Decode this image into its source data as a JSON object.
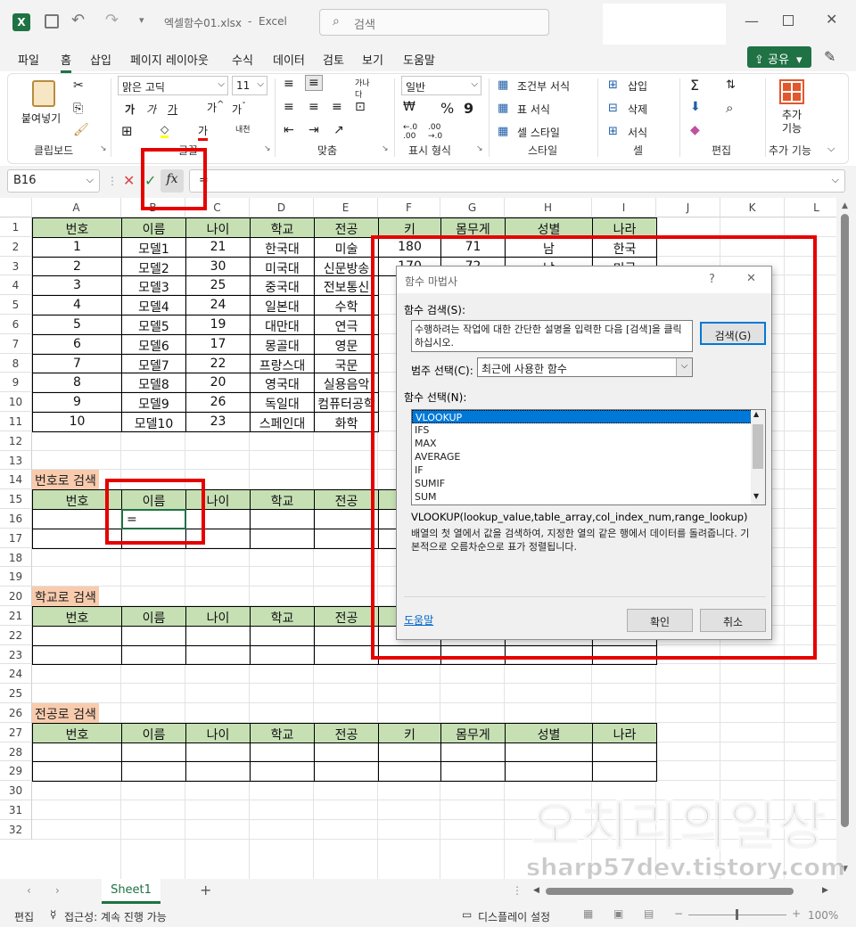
{
  "window": {
    "filename": "엑셀함수01.xlsx",
    "app": "Excel",
    "separator": "-",
    "search_placeholder": "검색"
  },
  "menu": [
    "파일",
    "홈",
    "삽입",
    "페이지 레이아웃",
    "수식",
    "데이터",
    "검토",
    "보기",
    "도움말"
  ],
  "share_label": "공유",
  "ribbon": {
    "paste": "붙여넣기",
    "font_name": "맑은 고딕",
    "font_size": "11",
    "number_format": "일반",
    "cond_format": "조건부 서식",
    "table_format": "표 서식",
    "cell_style": "셀 스타일",
    "insert": "삽입",
    "delete": "삭제",
    "format": "서식",
    "addins": "추가 기능",
    "groups": {
      "clipboard": "클립보드",
      "font": "글꼴",
      "align": "맞춤",
      "number": "표시 형식",
      "style": "스타일",
      "cells": "셀",
      "edit": "편집",
      "addins": "추가 기능"
    }
  },
  "formula_bar": {
    "name_box": "B16",
    "fx": "fx",
    "content": "="
  },
  "columns": [
    "A",
    "B",
    "C",
    "D",
    "E",
    "F",
    "G",
    "H",
    "I",
    "J",
    "K",
    "L"
  ],
  "rows": [
    "1",
    "2",
    "3",
    "4",
    "5",
    "6",
    "7",
    "8",
    "9",
    "10",
    "11",
    "12",
    "13",
    "14",
    "15",
    "16",
    "17",
    "18",
    "19",
    "20",
    "21",
    "22",
    "23",
    "24",
    "25",
    "26",
    "27",
    "28",
    "29",
    "30",
    "31",
    "32"
  ],
  "table": {
    "headers": [
      "번호",
      "이름",
      "나이",
      "학교",
      "전공",
      "키",
      "몸무게",
      "성별",
      "나라"
    ],
    "rows": [
      [
        "1",
        "모델1",
        "21",
        "한국대",
        "미술",
        "180",
        "71",
        "남",
        "한국"
      ],
      [
        "2",
        "모델2",
        "30",
        "미국대",
        "신문방송",
        "170",
        "72",
        "남",
        "미국"
      ],
      [
        "3",
        "모델3",
        "25",
        "중국대",
        "전보통신",
        "",
        "",
        "",
        ""
      ],
      [
        "4",
        "모델4",
        "24",
        "일본대",
        "수학",
        "",
        "",
        "",
        ""
      ],
      [
        "5",
        "모델5",
        "19",
        "대만대",
        "연극",
        "",
        "",
        "",
        ""
      ],
      [
        "6",
        "모델6",
        "17",
        "몽골대",
        "영문",
        "",
        "",
        "",
        ""
      ],
      [
        "7",
        "모델7",
        "22",
        "프랑스대",
        "국문",
        "",
        "",
        "",
        ""
      ],
      [
        "8",
        "모델8",
        "20",
        "영국대",
        "실용음악",
        "",
        "",
        "",
        ""
      ],
      [
        "9",
        "모델9",
        "26",
        "독일대",
        "컴퓨터공학",
        "",
        "",
        "",
        ""
      ],
      [
        "10",
        "모델10",
        "23",
        "스페인대",
        "화학",
        "",
        "",
        "",
        ""
      ]
    ]
  },
  "sections": {
    "by_number": "번호로 검색",
    "by_school": "학교로 검색",
    "by_major": "전공로 검색",
    "cell_b16": "="
  },
  "dialog": {
    "title": "함수 마법사",
    "help_q": "?",
    "close": "✕",
    "search_label": "함수 검색(S):",
    "search_text": "수행하려는 작업에 대한 간단한 설명을 입력한 다음 [검색]을 클릭하십시오.",
    "search_btn": "검색(G)",
    "category_label": "범주 선택(C):",
    "category_value": "최근에 사용한 함수",
    "select_label": "함수 선택(N):",
    "functions": [
      "VLOOKUP",
      "IFS",
      "MAX",
      "AVERAGE",
      "IF",
      "SUMIF",
      "SUM"
    ],
    "signature": "VLOOKUP(lookup_value,table_array,col_index_num,range_lookup)",
    "description": "배열의 첫 열에서 값을 검색하여, 지정한 열의 같은 행에서 데이터를 돌려줍니다. 기본적으로 오름차순으로 표가 정렬됩니다.",
    "help_link": "도움말",
    "ok": "확인",
    "cancel": "취소"
  },
  "sheet_tab": "Sheet1",
  "status": {
    "mode": "편집",
    "accessibility": "접근성: 계속 진행 가능",
    "display": "디스플레이 설정",
    "zoom": "100%"
  },
  "watermark": {
    "line1": "오치리의일상",
    "line2": "sharp57dev.tistory.com"
  }
}
